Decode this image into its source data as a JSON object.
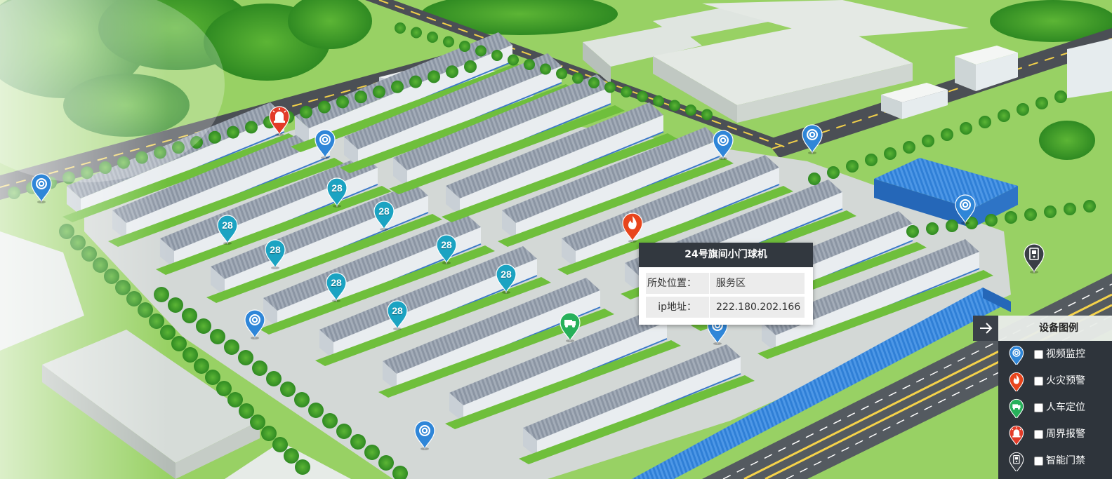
{
  "colors": {
    "video": "#2f86d8",
    "fire": "#e8451c",
    "personnel": "#27b05a",
    "perimeter": "#e33b28",
    "access": "#3a3f46",
    "building_pin": "#1ba3c2"
  },
  "markers": [
    {
      "type": "video",
      "icon": "camera-icon",
      "label": ""
    },
    {
      "type": "video",
      "icon": "camera-icon",
      "label": ""
    },
    {
      "type": "video",
      "icon": "camera-icon",
      "label": ""
    },
    {
      "type": "video",
      "icon": "camera-icon",
      "label": ""
    },
    {
      "type": "video",
      "icon": "camera-icon",
      "label": ""
    },
    {
      "type": "video",
      "icon": "camera-icon",
      "label": ""
    },
    {
      "type": "video",
      "icon": "camera-icon",
      "label": ""
    },
    {
      "type": "video",
      "icon": "camera-icon",
      "label": ""
    },
    {
      "type": "perimeter",
      "icon": "alarm-light-icon",
      "label": ""
    },
    {
      "type": "fire",
      "icon": "flame-icon",
      "label": ""
    },
    {
      "type": "personnel",
      "icon": "vehicle-person-icon",
      "label": ""
    },
    {
      "type": "access",
      "icon": "door-access-icon",
      "label": ""
    },
    {
      "type": "building",
      "icon": "",
      "label": "28"
    },
    {
      "type": "building",
      "icon": "",
      "label": "28"
    },
    {
      "type": "building",
      "icon": "",
      "label": "28"
    },
    {
      "type": "building",
      "icon": "",
      "label": "28"
    },
    {
      "type": "building",
      "icon": "",
      "label": "28"
    },
    {
      "type": "building",
      "icon": "",
      "label": "28"
    },
    {
      "type": "building",
      "icon": "",
      "label": "28"
    },
    {
      "type": "building",
      "icon": "",
      "label": "28"
    }
  ],
  "popup": {
    "title": "24号旗间小门球机",
    "rows": [
      {
        "label": "所处位置：",
        "value": "服务区"
      },
      {
        "label": "ip地址：",
        "value": "222.180.202.166"
      }
    ]
  },
  "legend": {
    "title": "设备图例",
    "items": [
      {
        "label": "视频监控",
        "icon": "camera-pin-icon",
        "color": "#2f86d8"
      },
      {
        "label": "火灾预警",
        "icon": "fire-pin-icon",
        "color": "#e8451c"
      },
      {
        "label": "人车定位",
        "icon": "personnel-pin-icon",
        "color": "#27b05a"
      },
      {
        "label": "周界报警",
        "icon": "alarm-pin-icon",
        "color": "#e33b28"
      },
      {
        "label": "智能门禁",
        "icon": "access-pin-icon",
        "color": "#3a3f46"
      }
    ]
  }
}
